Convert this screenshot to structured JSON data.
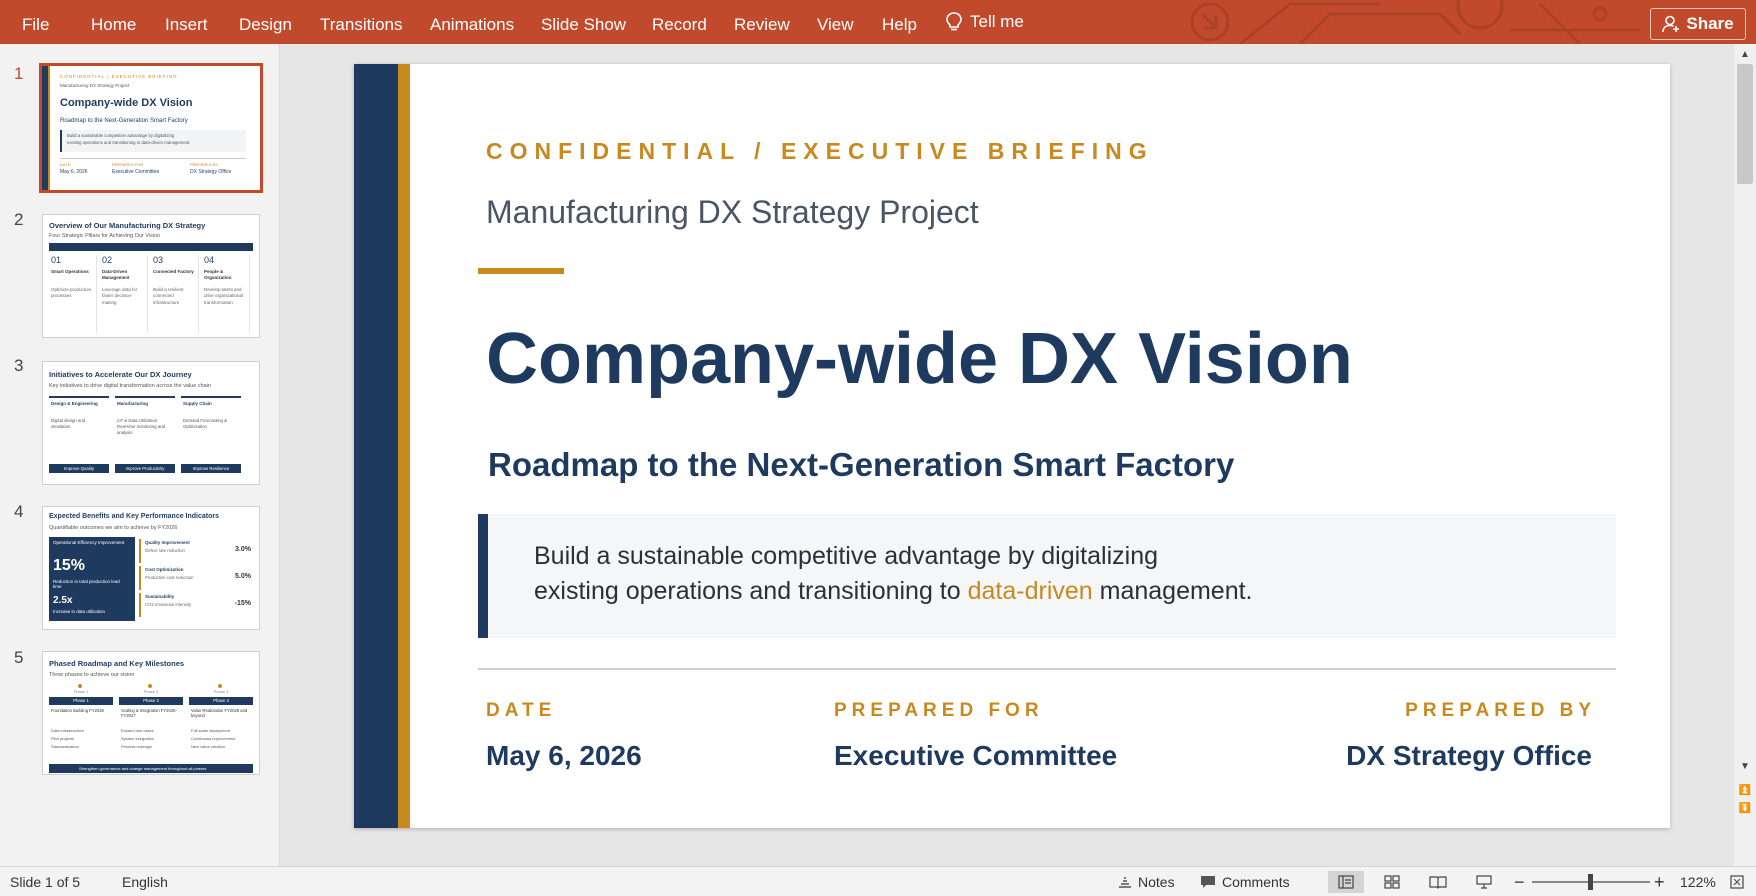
{
  "ribbon": {
    "tabs": [
      "File",
      "Home",
      "Insert",
      "Design",
      "Transitions",
      "Animations",
      "Slide Show",
      "Record",
      "Review",
      "View",
      "Help"
    ],
    "tell_me": "Tell me",
    "share": "Share",
    "accent": "#c24a2c"
  },
  "thumbnails": [
    {
      "number": "1",
      "selected": true,
      "eyebrow": "CONFIDENTIAL / EXECUTIVE BRIEFING",
      "project": "Manufacturing DX Strategy Project",
      "title": "Company-wide DX Vision",
      "subtitle": "Roadmap to the Next-Generation Smart Factory",
      "callout": [
        "Build a sustainable competitive advantage by digitalizing",
        "existing operations and transitioning to data-driven management."
      ],
      "meta": [
        {
          "label": "DATE",
          "value": "May 6, 2026"
        },
        {
          "label": "PREPARED FOR",
          "value": "Executive Committee"
        },
        {
          "label": "PREPARED BY",
          "value": "DX Strategy Office"
        }
      ]
    },
    {
      "number": "2",
      "title": "Overview of Our Manufacturing DX Strategy",
      "subtitle": "Four Strategic Pillars for Achieving Our Vision",
      "pillars": [
        {
          "num": "01",
          "name": "Smart Operations",
          "text": "Optimize production processes"
        },
        {
          "num": "02",
          "name": "Data-Driven Management",
          "text": "Leverage data for faster decision-making"
        },
        {
          "num": "03",
          "name": "Connected Factory",
          "text": "Build a resilient connected infrastructure"
        },
        {
          "num": "04",
          "name": "People & Organization",
          "text": "Develop talent and drive organizational transformation"
        }
      ]
    },
    {
      "number": "3",
      "title": "Initiatives to Accelerate Our DX Journey",
      "subtitle": "Key initiatives to drive digital transformation across the value chain",
      "columns": [
        {
          "head": "Design & Engineering",
          "text": "Digital design and simulation",
          "foot": "Improve Quality"
        },
        {
          "head": "Manufacturing",
          "text": "IoT & Data Utilization. Real-time monitoring and analysis",
          "foot": "Improve Productivity"
        },
        {
          "head": "Supply Chain",
          "text": "Demand Forecasting & Optimization",
          "foot": "Improve Resilience"
        }
      ]
    },
    {
      "number": "4",
      "title": "Expected Benefits and Key Performance Indicators",
      "subtitle": "Quantifiable outcomes we aim to achieve by FY2026",
      "hero": {
        "label": "Operational Efficiency Improvement",
        "big": "15%",
        "note": "Reduction in total production lead time",
        "big2": "2.5x",
        "note2": "Increase in data utilization"
      },
      "kpis": [
        {
          "name": "Quality Improvement",
          "desc": "Defect rate reduction",
          "value": "3.0%"
        },
        {
          "name": "Cost Optimization",
          "desc": "Production cost reduction",
          "value": "5.0%"
        },
        {
          "name": "Sustainability",
          "desc": "CO2 emissions intensity",
          "value": "-15%"
        }
      ]
    },
    {
      "number": "5",
      "title": "Phased Roadmap and Key Milestones",
      "subtitle": "Three phases to achieve our vision",
      "phases": [
        {
          "name": "Phase 1",
          "title": "Foundation Building FY2026",
          "items": [
            "Data infrastructure",
            "Pilot projects",
            "Standardization"
          ]
        },
        {
          "name": "Phase 2",
          "title": "Scaling & Integration FY2026-FY2027",
          "items": [
            "Expand use cases",
            "System integration",
            "Process redesign"
          ]
        },
        {
          "name": "Phase 3",
          "title": "Value Realization FY2028 and beyond",
          "items": [
            "Full-scale deployment",
            "Continuous improvement",
            "New value creation"
          ]
        }
      ],
      "footer": "Strengthen governance and change management throughout all phases"
    }
  ],
  "slide": {
    "eyebrow": "CONFIDENTIAL / EXECUTIVE BRIEFING",
    "project": "Manufacturing DX Strategy Project",
    "title": "Company-wide DX Vision",
    "subtitle": "Roadmap to the Next-Generation Smart Factory",
    "callout_line1": "Build a sustainable competitive advantage by digitalizing",
    "callout_line2_pre": "existing operations and transitioning to ",
    "callout_highlight": "data-driven",
    "callout_line2_post": " management.",
    "date_label": "DATE",
    "date_value": "May 6, 2026",
    "for_label": "PREPARED FOR",
    "for_value": "Executive Committee",
    "by_label": "PREPARED BY",
    "by_value": "DX Strategy Office",
    "navy": "#1f3a5f",
    "gold": "#c8891f"
  },
  "status": {
    "slide_info": "Slide 1 of 5",
    "language": "English",
    "notes": "Notes",
    "comments": "Comments",
    "zoom": "122%"
  }
}
